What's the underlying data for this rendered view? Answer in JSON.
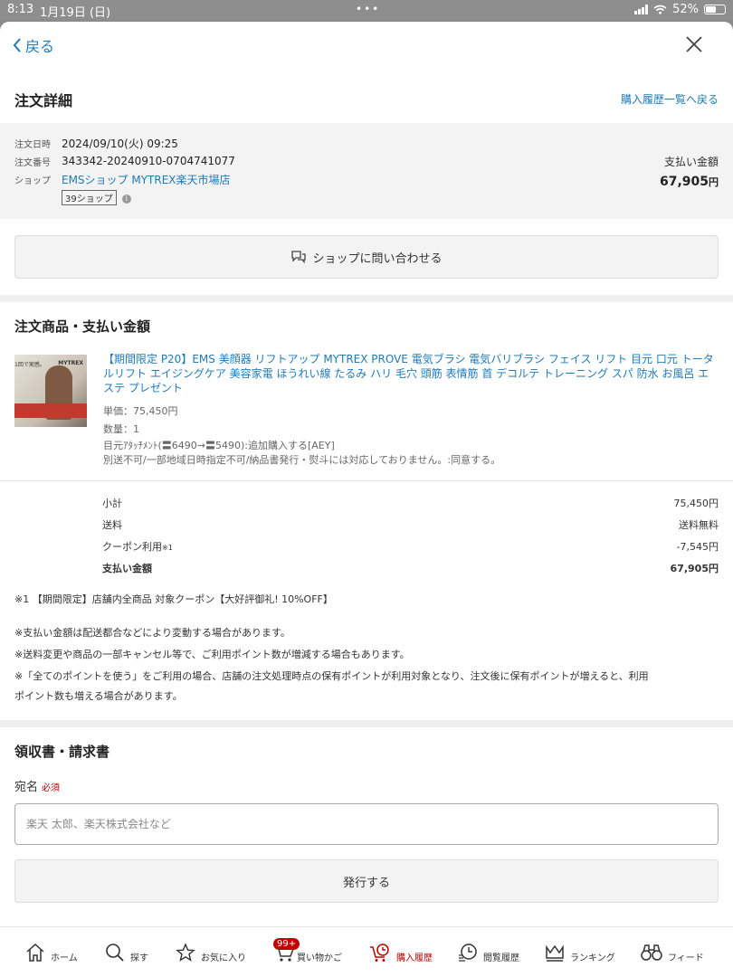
{
  "statusbar": {
    "time": "8:13",
    "date": "1月19日 (日)",
    "battery": "52%"
  },
  "nav": {
    "back_label": "戻る"
  },
  "header": {
    "title": "注文詳細",
    "history_link": "購入履歴一覧へ戻る"
  },
  "order": {
    "date_label": "注文日時",
    "date_value": "2024/09/10(火) 09:25",
    "number_label": "注文番号",
    "number_value": "343342-20240910-0704741077",
    "shop_label": "ショップ",
    "shop_name": "EMSショップ MYTREX楽天市場店",
    "shop_badge": "39ショップ",
    "paid_label": "支払い金額",
    "paid_value": "67,905",
    "paid_unit": "円"
  },
  "contact_button": "ショップに問い合わせる",
  "products_section": {
    "title": "注文商品・支払い金額",
    "thumbnail": {
      "brand": "MYTREX",
      "caption": "1回で実感。"
    },
    "item": {
      "title": "【期間限定 P20】EMS 美顔器 リフトアップ MYTREX PROVE 電気ブラシ 電気バリブラシ フェイス リフト 目元 口元 トータルリフト エイジングケア 美容家電 ほうれい線 たるみ ハリ 毛穴 頭筋 表情筋 首 デコルテ トレーニング スパ 防水 お風呂 エステ プレゼント",
      "unit_price": "単価：75,450円",
      "quantity": "数量：1",
      "option1": "目元ｱﾀｯﾁﾒﾝﾄ(〓6490→〓5490):追加購入する[AEY]",
      "option2": "別送不可/一部地域日時指定不可/納品書発行・熨斗には対応しておりません。:同意する。"
    }
  },
  "summary": {
    "subtotal_label": "小計",
    "subtotal_value": "75,450円",
    "shipping_label": "送料",
    "shipping_value": "送料無料",
    "coupon_label": "クーポン利用",
    "coupon_mark": "※1",
    "coupon_value": "-7,545円",
    "total_label": "支払い金額",
    "total_value": "67,905円"
  },
  "notes": {
    "coupon_note": "※1 【期間限定】店舗内全商品 対象クーポン【大好評御礼! 10%OFF】",
    "n1": "※支払い金額は配送都合などにより変動する場合があります。",
    "n2": "※送料変更や商品の一部キャンセル等で、ご利用ポイント数が増減する場合もあります。",
    "n3a": "※「全てのポイントを使う」をご利用の場合、店舗の注文処理時点の保有ポイントが利用対象となり、注文後に保有ポイントが増えると、利用",
    "n3b": "ポイント数も増える場合があります。"
  },
  "receipt": {
    "title": "領収書・請求書",
    "field_label": "宛名",
    "required": "必須",
    "placeholder": "楽天 太郎、楽天株式会社など",
    "issue_button": "発行する"
  },
  "tabbar": {
    "home": "ホーム",
    "search": "探す",
    "favorites": "お気に入り",
    "cart": "買い物かご",
    "cart_badge": "99+",
    "history": "購入履歴",
    "browsing": "閲覧履歴",
    "ranking": "ランキング",
    "feed": "フィード"
  },
  "colors": {
    "link": "#1f7ab8",
    "brand_red": "#bf0000"
  }
}
